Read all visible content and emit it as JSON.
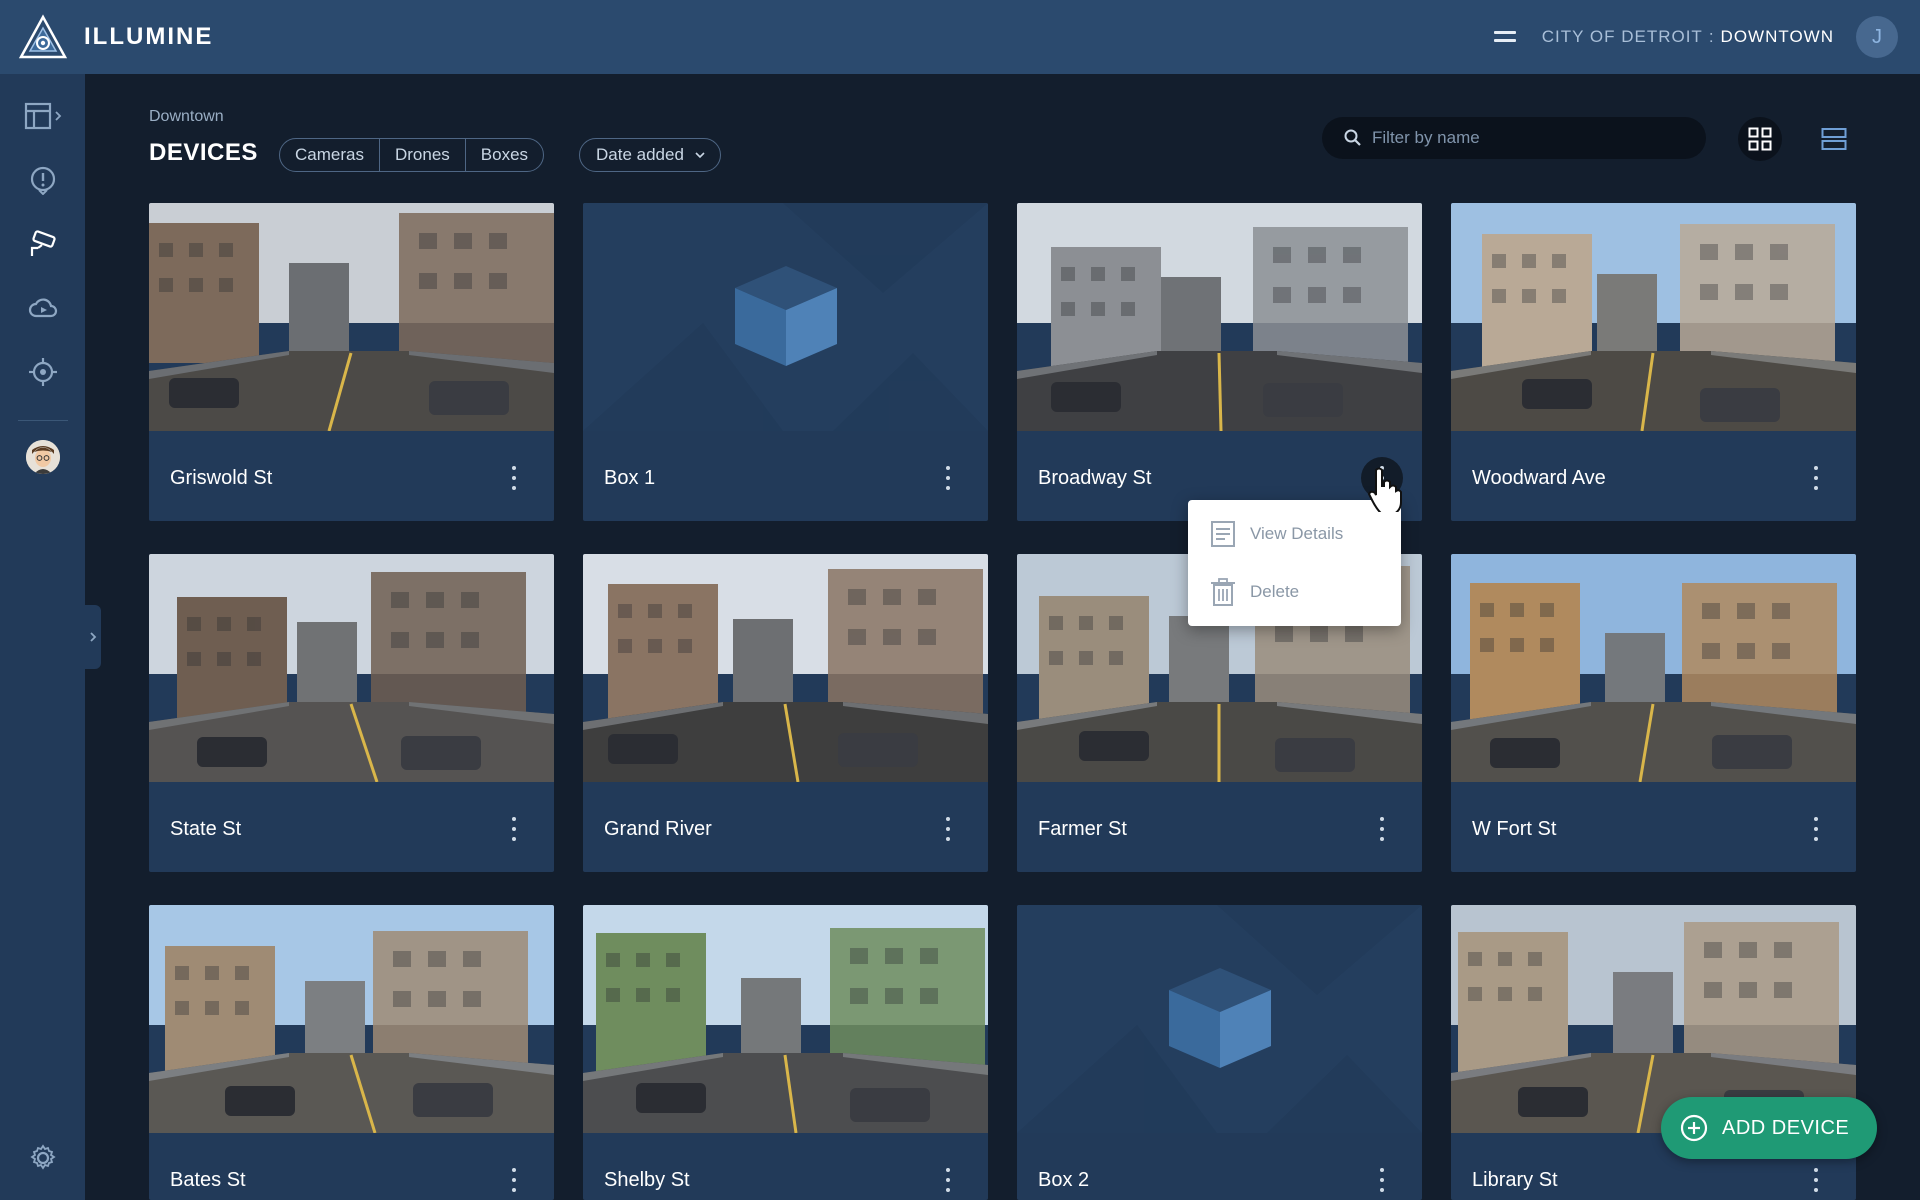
{
  "app": {
    "name": "ILLUMINE"
  },
  "header": {
    "location_city": "CITY OF DETROIT",
    "location_separator": ":",
    "location_current": "DOWNTOWN",
    "user_initial": "J"
  },
  "page": {
    "breadcrumb": "Downtown",
    "title": "DEVICES"
  },
  "filters": {
    "segments": [
      "Cameras",
      "Drones",
      "Boxes"
    ],
    "sort_label": "Date added"
  },
  "search": {
    "placeholder": "Filter by name",
    "value": ""
  },
  "devices": [
    {
      "name": "Griswold St",
      "type": "camera",
      "scene": "street-1"
    },
    {
      "name": "Box 1",
      "type": "box",
      "scene": "box"
    },
    {
      "name": "Broadway St",
      "type": "camera",
      "scene": "street-2"
    },
    {
      "name": "Woodward Ave",
      "type": "camera",
      "scene": "street-3"
    },
    {
      "name": "State St",
      "type": "camera",
      "scene": "street-4"
    },
    {
      "name": "Grand River",
      "type": "camera",
      "scene": "street-5"
    },
    {
      "name": "Farmer St",
      "type": "camera",
      "scene": "street-6"
    },
    {
      "name": "W Fort St",
      "type": "camera",
      "scene": "street-7"
    },
    {
      "name": "Bates St",
      "type": "camera",
      "scene": "street-8"
    },
    {
      "name": "Shelby St",
      "type": "camera",
      "scene": "street-9"
    },
    {
      "name": "Box 2",
      "type": "box",
      "scene": "box"
    },
    {
      "name": "Library St",
      "type": "camera",
      "scene": "street-10"
    }
  ],
  "context_menu": {
    "view_details": "View Details",
    "delete": "Delete"
  },
  "fab": {
    "label": "ADD DEVICE"
  },
  "sidebar": {
    "icons": [
      "layout-icon",
      "alert-icon",
      "camera-icon",
      "cloud-icon",
      "target-icon",
      "avatar",
      "settings-icon"
    ]
  },
  "colors": {
    "background": "#131e2d",
    "topbar": "#2b4a6e",
    "sidebar": "#223a59",
    "card": "#223a59",
    "accent_green": "#1f9a75"
  }
}
